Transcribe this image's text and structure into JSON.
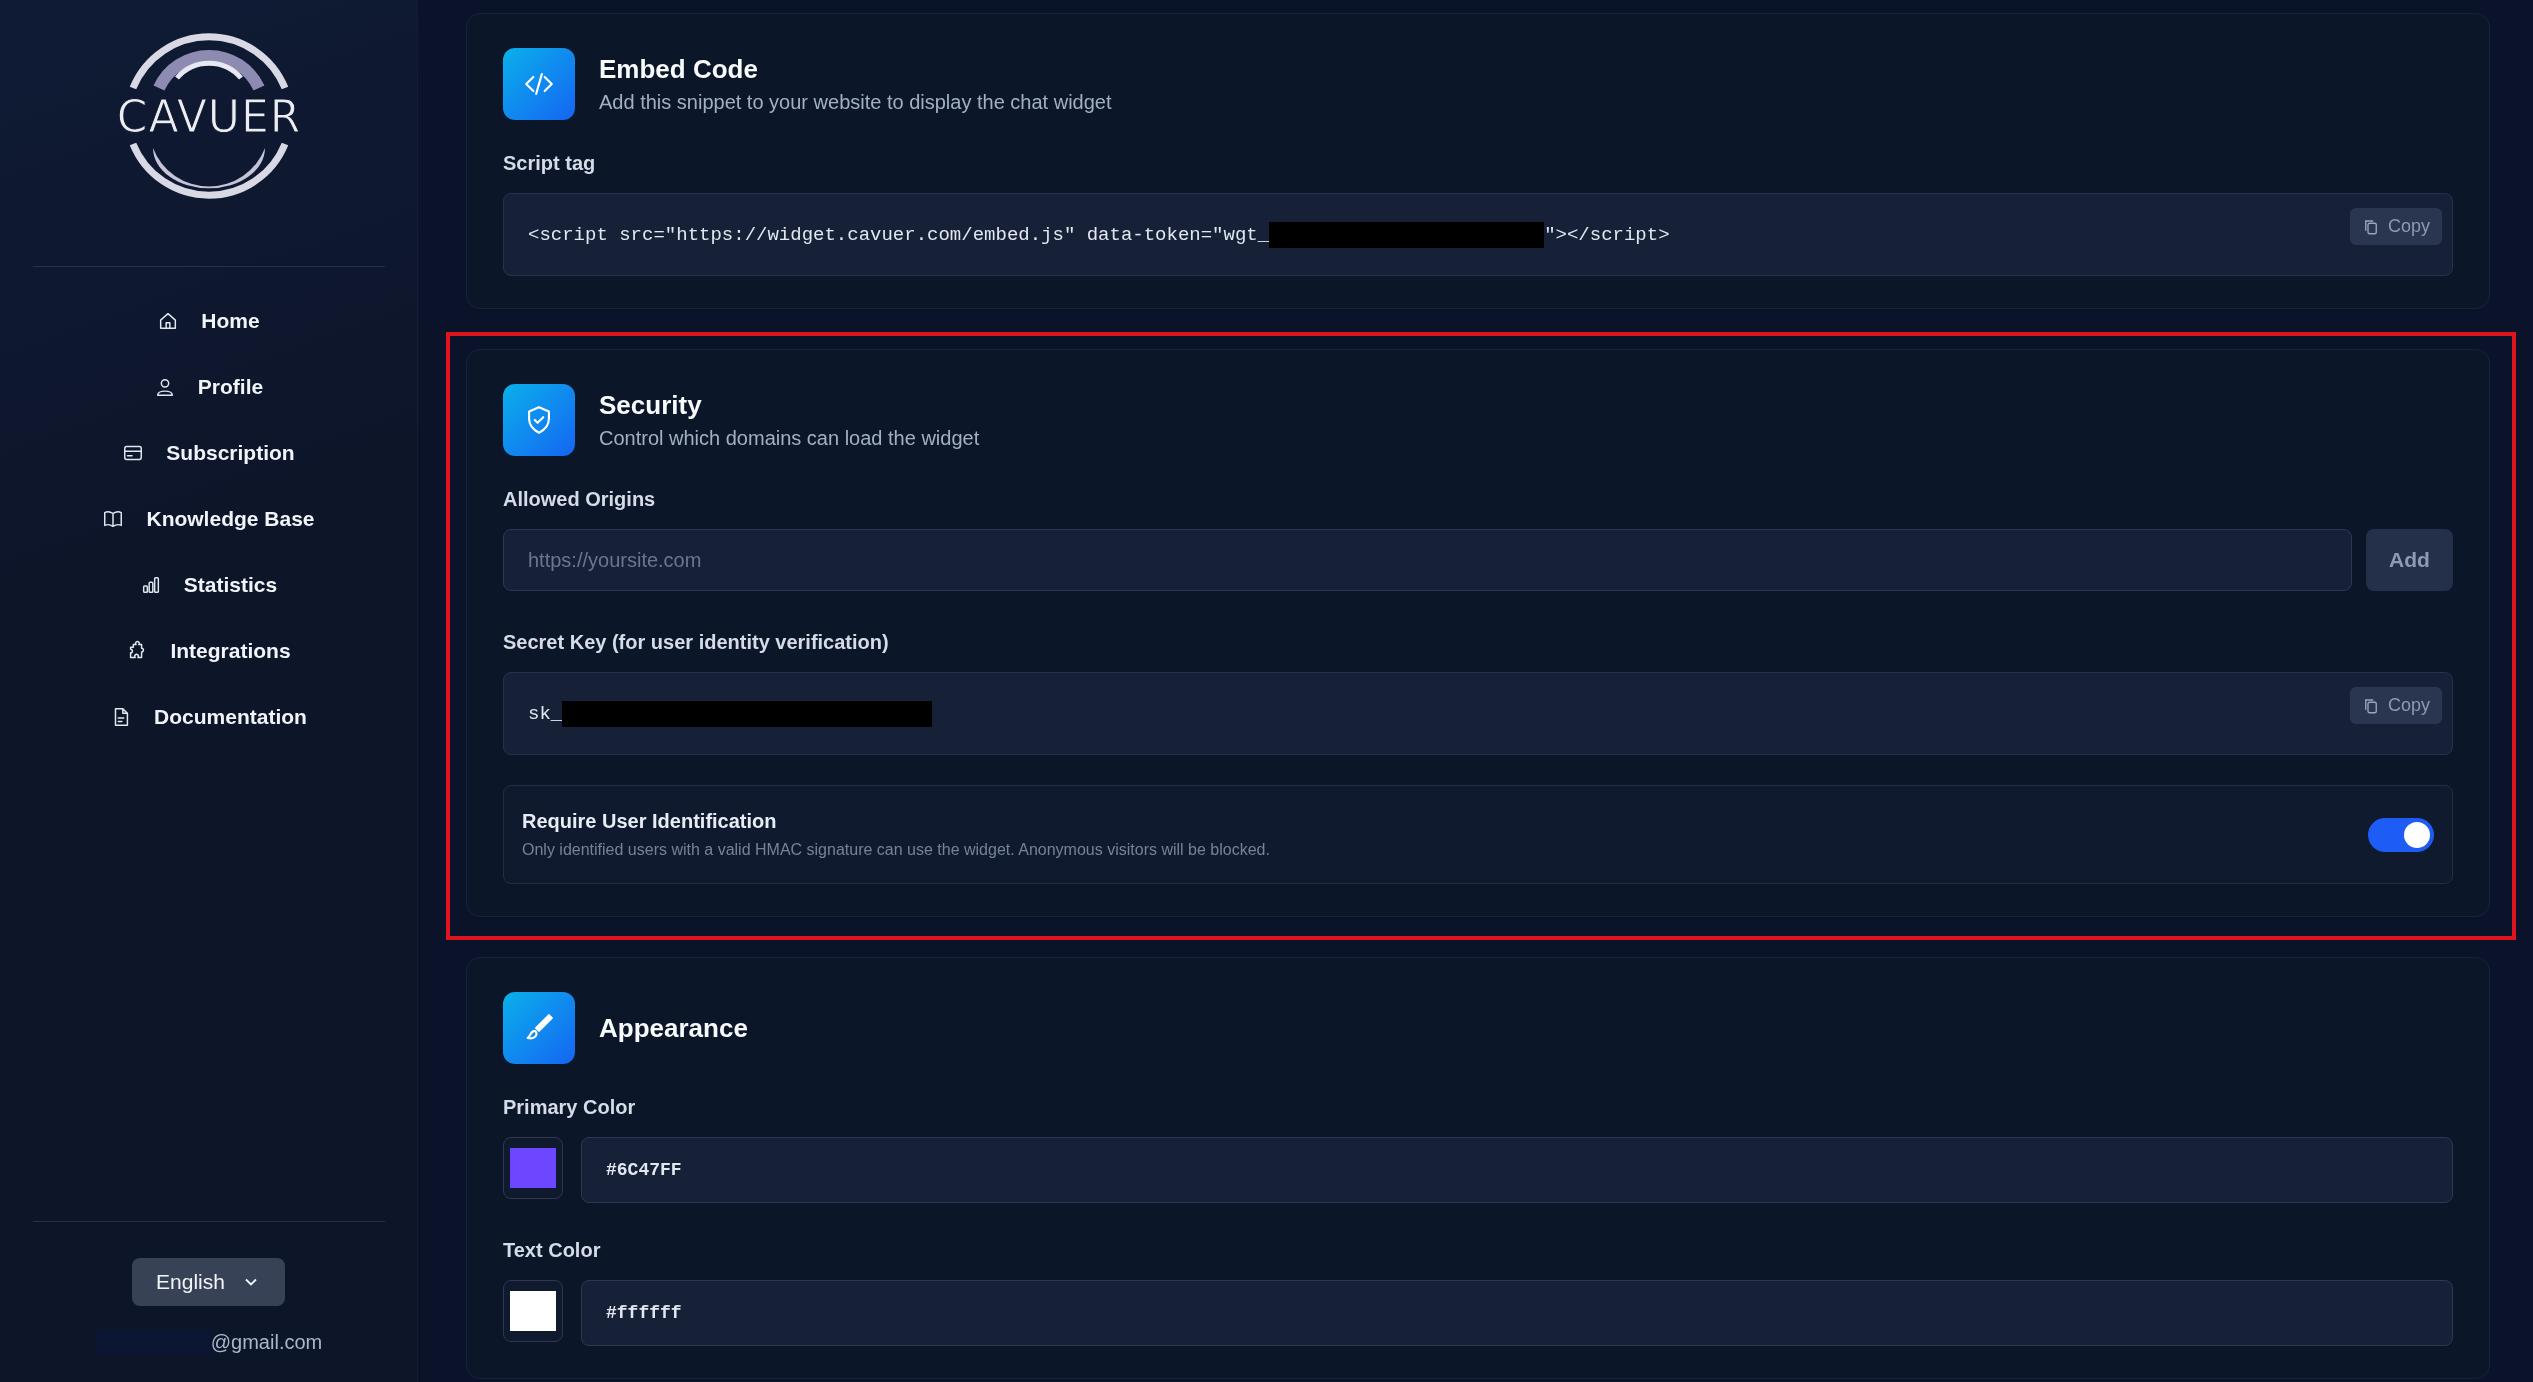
{
  "sidebar": {
    "logo": "CAVUER",
    "nav": [
      {
        "label": "Home",
        "kind": "home"
      },
      {
        "label": "Profile",
        "kind": "user"
      },
      {
        "label": "Subscription",
        "kind": "card"
      },
      {
        "label": "Knowledge Base",
        "kind": "book"
      },
      {
        "label": "Statistics",
        "kind": "chart"
      },
      {
        "label": "Integrations",
        "kind": "puzzle"
      },
      {
        "label": "Documentation",
        "kind": "doc"
      }
    ],
    "language": "English",
    "email": "@gmail.com"
  },
  "embed": {
    "title": "Embed Code",
    "subtitle": "Add this snippet to your website to display the chat widget",
    "label": "Script tag",
    "code_prefix": "<script src=\"https://widget.cavuer.com/embed.js\" data-token=\"wgt_",
    "code_suffix": "\"></script>",
    "copy": "Copy"
  },
  "security": {
    "highlighted": true,
    "title": "Security",
    "subtitle": "Control which domains can load the widget",
    "origins_label": "Allowed Origins",
    "origins_placeholder": "https://yoursite.com",
    "add": "Add",
    "secret_label": "Secret Key (for user identity verification)",
    "secret_prefix": "sk_",
    "copy": "Copy",
    "require": {
      "title": "Require User Identification",
      "description": "Only identified users with a valid HMAC signature can use the widget. Anonymous visitors will be blocked.",
      "on": true
    }
  },
  "appearance": {
    "title": "Appearance",
    "fields": [
      {
        "label": "Primary Color",
        "value": "#6C47FF"
      },
      {
        "label": "Text Color",
        "value": "#ffffff"
      }
    ]
  }
}
